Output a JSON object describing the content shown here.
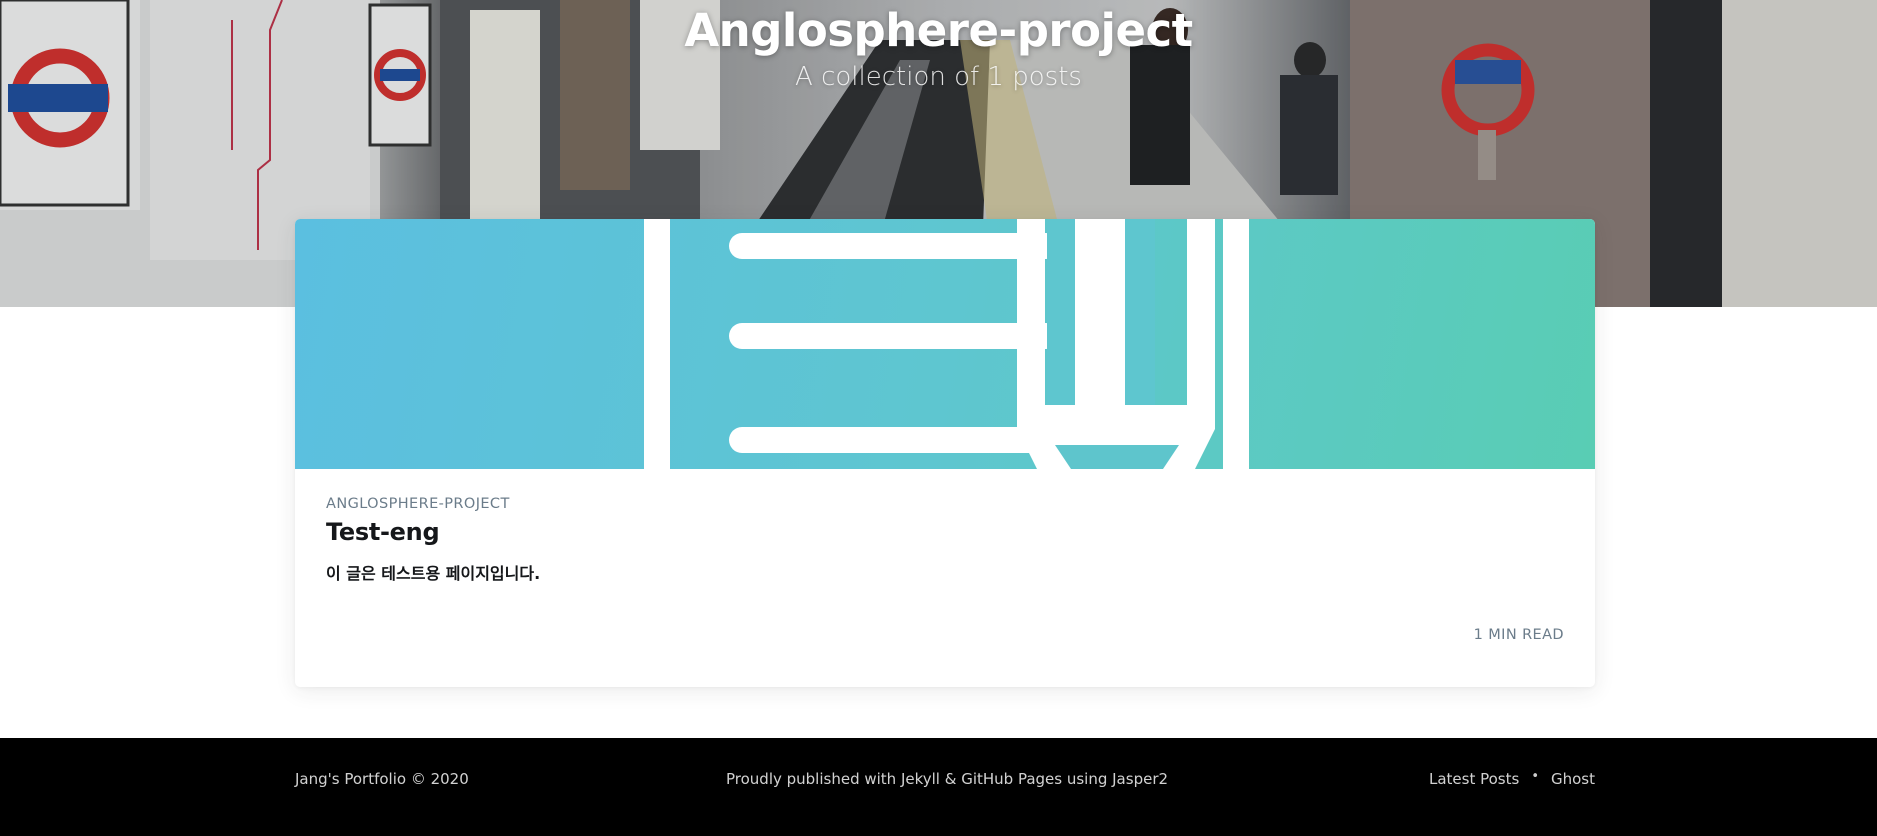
{
  "header": {
    "title": "Anglosphere-project",
    "description": "A collection of 1 posts",
    "background_theme": "london-underground-station-photo"
  },
  "posts": [
    {
      "tag": "ANGLOSPHERE-PROJECT",
      "title": "Test-eng",
      "excerpt": "이 글은 테스트용 페이지입니다.",
      "reading_time": "1 MIN READ",
      "image_icon": "notebook-pencil-icon",
      "image_colors": [
        "#5bbfe0",
        "#59cdb4"
      ]
    }
  ],
  "footer": {
    "copyright": "Jang's Portfolio © 2020",
    "credit": "Proudly published with Jekyll & GitHub Pages using Jasper2",
    "nav": [
      {
        "label": "Latest Posts"
      },
      {
        "label": "Ghost"
      }
    ],
    "separator": "•"
  }
}
